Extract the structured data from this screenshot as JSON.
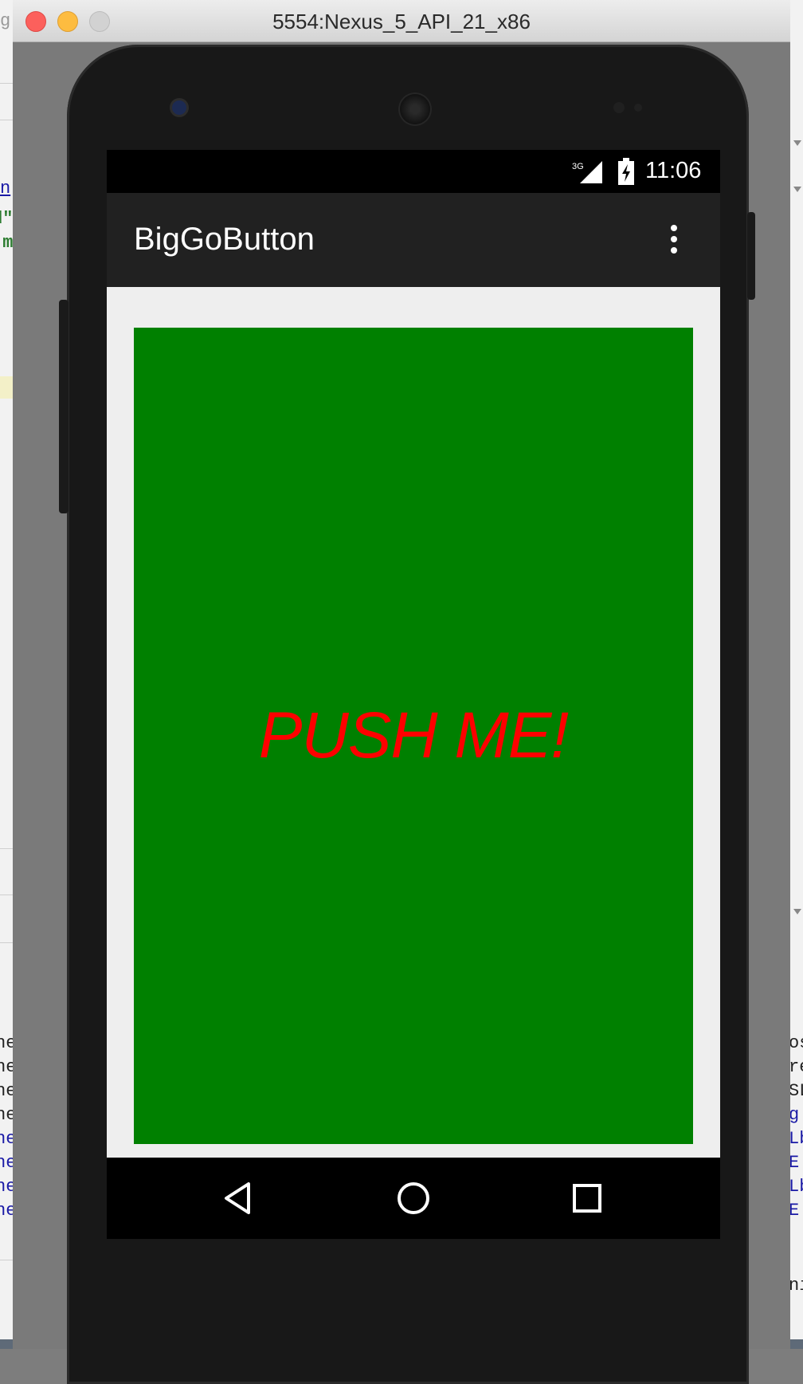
{
  "window": {
    "title": "5554:Nexus_5_API_21_x86"
  },
  "background_ide": {
    "left_fragments": [
      "n",
      "d\"",
      "'m",
      "ne",
      "ne",
      "ne",
      "ne",
      "ne",
      "ne",
      "ne",
      "ne"
    ],
    "right_fragments": [
      "os",
      "re",
      "SL",
      "g",
      "Lb",
      "E",
      "Lb",
      "E",
      "ni"
    ],
    "left_partial": "g"
  },
  "status_bar": {
    "network": "3G",
    "time": "11:06"
  },
  "app_bar": {
    "title": "BigGoButton",
    "menu_icon": "more-vert-icon"
  },
  "main": {
    "button_label": "PUSH ME!",
    "button_color": "#008000",
    "label_color": "#ff0000"
  },
  "nav_bar": {
    "back_icon": "back-triangle-icon",
    "home_icon": "home-circle-icon",
    "recents_icon": "recents-square-icon"
  }
}
